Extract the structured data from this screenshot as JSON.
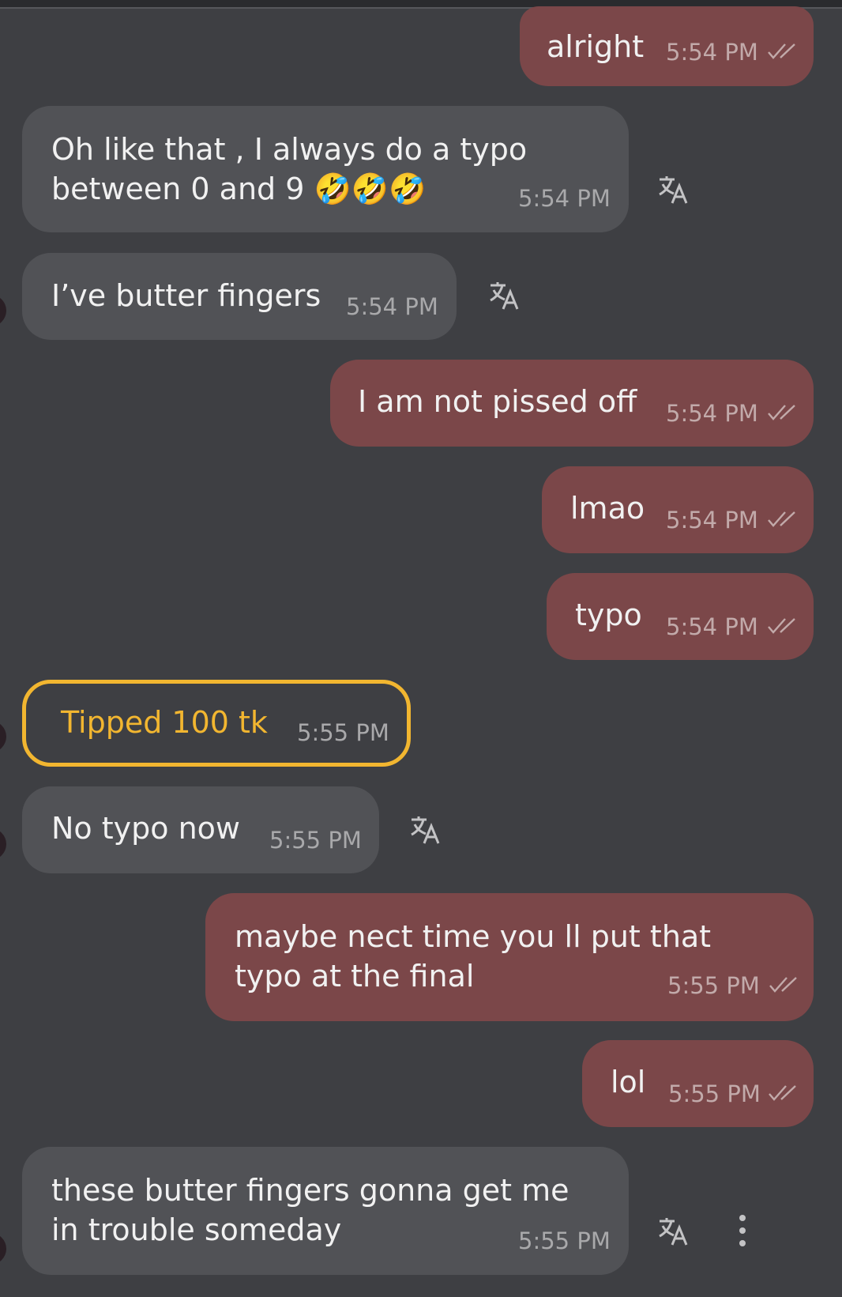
{
  "messages": [
    {
      "id": "m1",
      "text": "alright",
      "time": "5:54 PM"
    },
    {
      "id": "m2",
      "line1": "Oh like that , I always do a typo",
      "line2": "between 0 and 9 🤣🤣🤣",
      "time": "5:54 PM"
    },
    {
      "id": "m3",
      "text": "I’ve butter fingers",
      "time": "5:54 PM"
    },
    {
      "id": "m4",
      "text": "I am not pissed off",
      "time": "5:54 PM"
    },
    {
      "id": "m5",
      "text": "lmao",
      "time": "5:54 PM"
    },
    {
      "id": "m6",
      "text": "typo",
      "time": "5:54 PM"
    },
    {
      "id": "m7",
      "text": "Tipped 100 tk",
      "time": "5:55 PM"
    },
    {
      "id": "m8",
      "text": "No typo now",
      "time": "5:55 PM"
    },
    {
      "id": "m9",
      "line1": "maybe nect time you ll put that",
      "line2": "typo at the final",
      "time": "5:55 PM"
    },
    {
      "id": "m10",
      "text": "lol",
      "time": "5:55 PM"
    },
    {
      "id": "m11",
      "line1": "these butter fingers gonna get me",
      "line2": "in trouble someday",
      "time": "5:55 PM"
    }
  ],
  "icons": {
    "read_receipt": "double-check-icon",
    "translate": "translate-icon",
    "more": "more-vertical-icon"
  },
  "colors": {
    "background": "#3e3f43",
    "outgoing_bubble": "#7b4749",
    "incoming_bubble": "#515256",
    "tip_accent": "#f2b630"
  }
}
